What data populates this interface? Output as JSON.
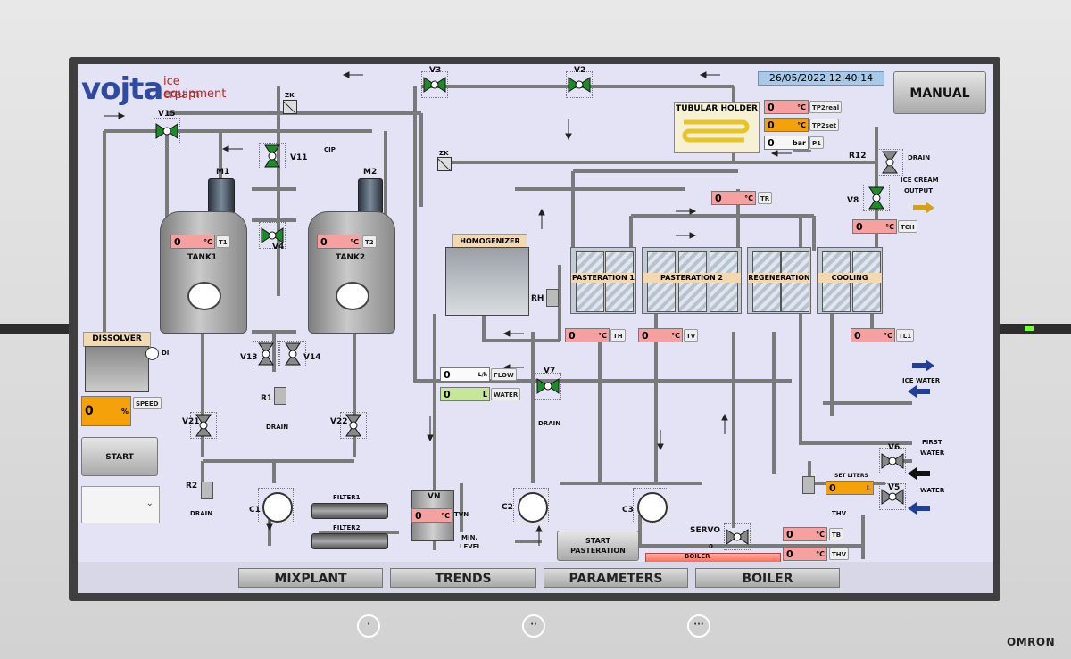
{
  "brand": {
    "name": "vojta",
    "sub1": "ice cream",
    "sub2": "equipment"
  },
  "datetime": "26/05/2022 12:40:14",
  "mode_button": "MANUAL",
  "nav": [
    "MIXPLANT",
    "TRENDS",
    "PARAMETERS",
    "BOILER"
  ],
  "buttons": {
    "start": "START",
    "start_pasteration": "START\nPASTERATION",
    "start_pasteration_l1": "START",
    "start_pasteration_l2": "PASTERATION"
  },
  "tanks": {
    "t1_name": "TANK1",
    "t2_name": "TANK2",
    "m1": "M1",
    "m2": "M2"
  },
  "valves": {
    "v15": "V15",
    "v11": "V11",
    "v4": "V4",
    "v3": "V3",
    "v2": "V2",
    "v13": "V13",
    "v14": "V14",
    "v21": "V21",
    "v22": "V22",
    "v7": "V7",
    "v8": "V8",
    "v6": "V6",
    "v5": "V5",
    "r12": "R12",
    "r1": "R1",
    "r2": "R2",
    "rh": "RH",
    "zk1": "ZK",
    "zk2": "ZK",
    "servo": "SERVO",
    "cip": "CIP"
  },
  "pumps": {
    "c1": "C1",
    "c2": "C2",
    "c3": "C3"
  },
  "equipment": {
    "dissolver": "DISSOLVER",
    "di": "DI",
    "homogenizer": "HOMOGENIZER",
    "tubular_holder": "TUBULAR HOLDER",
    "past1": "PASTERATION 1",
    "past2": "PASTERATION 2",
    "regen": "REGENERATION",
    "cooling": "COOLING",
    "filter1": "FILTER1",
    "filter2": "FILTER2",
    "vn": "VN",
    "min_level_1": "MIN.",
    "min_level_2": "LEVEL",
    "boiler": "BOILER",
    "thv": "THV"
  },
  "labels": {
    "drain": "DRAIN",
    "ice_cream_output_1": "ICE CREAM",
    "ice_cream_output_2": "OUTPUT",
    "ice_water": "ICE WATER",
    "first_water_1": "FIRST",
    "first_water_2": "WATER",
    "water": "WATER",
    "set_liters": "SET LITERS",
    "servo_val": "0"
  },
  "readings": {
    "t1": {
      "value": "0",
      "unit": "°C",
      "tag": "T1"
    },
    "t2": {
      "value": "0",
      "unit": "°C",
      "tag": "T2"
    },
    "tp2real": {
      "value": "0",
      "unit": "°C",
      "tag": "TP2real"
    },
    "tp2set": {
      "value": "0",
      "unit": "°C",
      "tag": "TP2set"
    },
    "p1": {
      "value": "0",
      "unit": "bar",
      "tag": "P1"
    },
    "tr": {
      "value": "0",
      "unit": "°C",
      "tag": "TR"
    },
    "tch": {
      "value": "0",
      "unit": "°C",
      "tag": "TCH"
    },
    "th": {
      "value": "0",
      "unit": "°C",
      "tag": "TH"
    },
    "tv": {
      "value": "0",
      "unit": "°C",
      "tag": "TV"
    },
    "tl1": {
      "value": "0",
      "unit": "°C",
      "tag": "TL1"
    },
    "flow": {
      "value": "0",
      "unit": "L/h",
      "tag": "FLOW"
    },
    "water": {
      "value": "0",
      "unit": "L",
      "tag": "WATER"
    },
    "speed": {
      "value": "0",
      "unit": "%",
      "tag": "SPEED"
    },
    "tvn": {
      "value": "0",
      "unit": "°C",
      "tag": "TVN"
    },
    "tb": {
      "value": "0",
      "unit": "°C",
      "tag": "TB"
    },
    "thv": {
      "value": "0",
      "unit": "°C",
      "tag": "THV"
    },
    "set_liters": {
      "value": "0",
      "unit": "L"
    }
  },
  "hw": {
    "omron": "OMRON",
    "b1": "·",
    "b2": "··",
    "b3": "···"
  },
  "colors": {
    "screen_bg": "#e4e3f5",
    "valve_green": "#1e8a2a",
    "value_red": "#f6a0a0",
    "value_orange": "#f5a10a",
    "flow_green": "#c6e79b",
    "arrow_blue": "#1f3f99",
    "arrow_gold": "#d4a21a"
  }
}
